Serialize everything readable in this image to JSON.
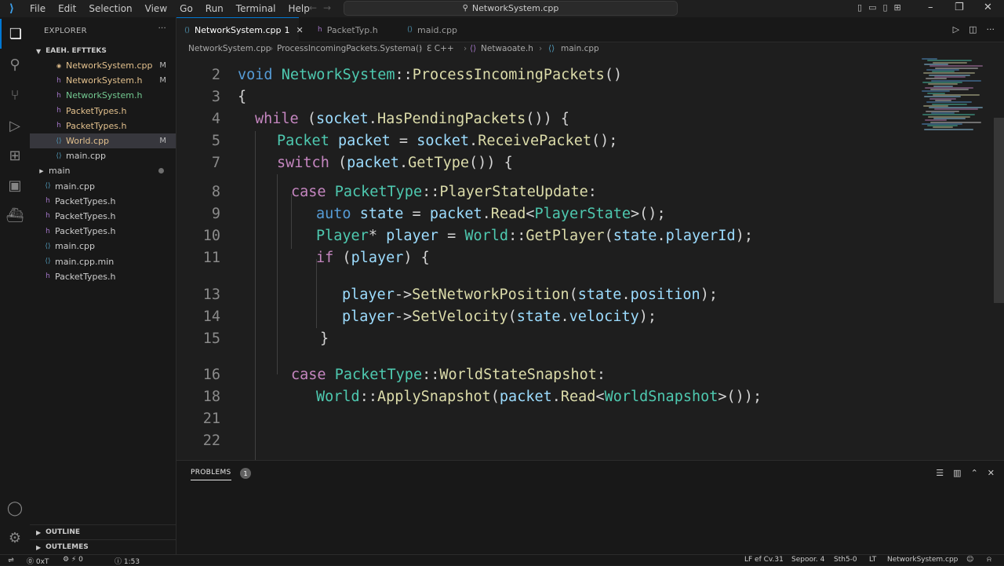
{
  "titlebar": {
    "menu": [
      "File",
      "Edit",
      "Selection",
      "View",
      "Go",
      "Run",
      "Terminal",
      "Help"
    ],
    "search_text": "NetworkSystem.cpp"
  },
  "sidebar": {
    "header": "EXPLORER",
    "section": "EAEH. EFTTEKS",
    "items": [
      {
        "label": "NetworkSystem.cpp",
        "status": "M",
        "color": "mod"
      },
      {
        "label": "NetworkSystem.h",
        "status": "M",
        "color": "mod"
      },
      {
        "label": "NetworkSystem.h",
        "status": "",
        "color": "new"
      },
      {
        "label": "PacketTypes.h",
        "status": "",
        "color": "mod"
      },
      {
        "label": "PacketTypes.h",
        "status": "",
        "color": "mod"
      },
      {
        "label": "World.cpp",
        "status": "M",
        "color": "mod"
      },
      {
        "label": "main.cpp",
        "status": "",
        "color": "def"
      },
      {
        "label": "main",
        "status": "",
        "color": "def"
      },
      {
        "label": "main.cpp",
        "status": "",
        "color": "def"
      },
      {
        "label": "PacketTypes.h",
        "status": "",
        "color": "def"
      },
      {
        "label": "PacketTypes.h",
        "status": "",
        "color": "def"
      },
      {
        "label": "PacketTypes.h",
        "status": "",
        "color": "def"
      },
      {
        "label": "main.cpp",
        "status": "",
        "color": "def"
      },
      {
        "label": "main.cpp.min",
        "status": "",
        "color": "def"
      },
      {
        "label": "PacketTypes.h",
        "status": "",
        "color": "def"
      }
    ],
    "outline": "OUTLINE",
    "outline2": "OUTLEMES"
  },
  "tabs": [
    {
      "label": "NetworkSystem.cpp",
      "badge": "1"
    },
    {
      "label": "PacketTyp.h"
    },
    {
      "label": "maid.cpp"
    }
  ],
  "breadcrumbs": [
    "NetworkSystem.cpp",
    "ProcessIncomingPackets.Systema()",
    "ℇ C++",
    "Netwaoate.h",
    "main.cpp"
  ],
  "code_lines": [
    {
      "n": "2",
      "t": [
        [
          "kw",
          "void "
        ],
        [
          "ty",
          "NetworkSystem"
        ],
        [
          "pn",
          "::"
        ],
        [
          "fn",
          "ProcessIncomingPackets"
        ],
        [
          "pn",
          "()"
        ]
      ]
    },
    {
      "n": "3",
      "t": [
        [
          "pn",
          "{"
        ]
      ]
    },
    {
      "n": "4",
      "t": [
        [
          "kc",
          "while "
        ],
        [
          "pn",
          "("
        ],
        [
          "var",
          "socket"
        ],
        [
          "pn",
          "."
        ],
        [
          "fn",
          "HasPendingPackets"
        ],
        [
          "pn",
          "()) {"
        ]
      ]
    },
    {
      "n": "5",
      "t": [
        [
          "ty",
          "Packet "
        ],
        [
          "var",
          "packet"
        ],
        [
          "pn",
          " = "
        ],
        [
          "var",
          "socket"
        ],
        [
          "pn",
          "."
        ],
        [
          "fn",
          "ReceivePacket"
        ],
        [
          "pn",
          "();"
        ]
      ]
    },
    {
      "n": "7",
      "t": [
        [
          "kc",
          "switch "
        ],
        [
          "pn",
          "("
        ],
        [
          "var",
          "packet"
        ],
        [
          "pn",
          "."
        ],
        [
          "fn",
          "GetType"
        ],
        [
          "pn",
          "()) {"
        ]
      ]
    },
    {
      "n": "8",
      "t": [
        [
          "kc",
          "case "
        ],
        [
          "ty",
          "PacketType"
        ],
        [
          "pn",
          "::"
        ],
        [
          "fn",
          "PlayerStateUpdate"
        ],
        [
          "pn",
          ":"
        ]
      ]
    },
    {
      "n": "9",
      "t": [
        [
          "kw",
          "auto "
        ],
        [
          "var",
          "state"
        ],
        [
          "pn",
          " = "
        ],
        [
          "var",
          "packet"
        ],
        [
          "pn",
          "."
        ],
        [
          "fn",
          "Read"
        ],
        [
          "pn",
          "<"
        ],
        [
          "ty",
          "PlayerState"
        ],
        [
          "pn",
          ">();"
        ]
      ]
    },
    {
      "n": "10",
      "t": [
        [
          "ty",
          "Player"
        ],
        [
          "pn",
          "* "
        ],
        [
          "var",
          "player"
        ],
        [
          "pn",
          " = "
        ],
        [
          "ty",
          "World"
        ],
        [
          "pn",
          "::"
        ],
        [
          "fn",
          "GetPlayer"
        ],
        [
          "pn",
          "("
        ],
        [
          "var",
          "state"
        ],
        [
          "pn",
          "."
        ],
        [
          "var",
          "playerId"
        ],
        [
          "pn",
          ");"
        ]
      ]
    },
    {
      "n": "11",
      "t": [
        [
          "kc",
          "if "
        ],
        [
          "pn",
          "("
        ],
        [
          "var",
          "player"
        ],
        [
          "pn",
          ") {"
        ]
      ]
    },
    {
      "n": "13",
      "t": [
        [
          "var",
          "player"
        ],
        [
          "pn",
          "->"
        ],
        [
          "fn",
          "SetNetworkPosition"
        ],
        [
          "pn",
          "("
        ],
        [
          "var",
          "state"
        ],
        [
          "pn",
          "."
        ],
        [
          "var",
          "position"
        ],
        [
          "pn",
          ");"
        ]
      ]
    },
    {
      "n": "14",
      "t": [
        [
          "var",
          "player"
        ],
        [
          "pn",
          "->"
        ],
        [
          "fn",
          "SetVelocity"
        ],
        [
          "pn",
          "("
        ],
        [
          "var",
          "state"
        ],
        [
          "pn",
          "."
        ],
        [
          "var",
          "velocity"
        ],
        [
          "pn",
          ");"
        ]
      ]
    },
    {
      "n": "15",
      "t": [
        [
          "pn",
          "}"
        ]
      ]
    },
    {
      "n": "16",
      "t": [
        [
          "kc",
          "case "
        ],
        [
          "ty",
          "PacketType"
        ],
        [
          "pn",
          "::"
        ],
        [
          "fn",
          "WorldStateSnapshot"
        ],
        [
          "pn",
          ":"
        ]
      ]
    },
    {
      "n": "18",
      "t": [
        [
          "ty",
          "World"
        ],
        [
          "pn",
          "::"
        ],
        [
          "fn",
          "ApplySnapshot"
        ],
        [
          "pn",
          "("
        ],
        [
          "var",
          "packet"
        ],
        [
          "pn",
          "."
        ],
        [
          "fn",
          "Read"
        ],
        [
          "pn",
          "<"
        ],
        [
          "ty",
          "WorldSnapshot"
        ],
        [
          "pn",
          ">());"
        ]
      ]
    },
    {
      "n": "21",
      "t": []
    },
    {
      "n": "22",
      "t": []
    }
  ],
  "panel": {
    "tab": "PROBLEMS",
    "count": "1"
  },
  "statusbar": {
    "left": [
      "⓪ 0x⁠T",
      "⚙ ⚡ 0",
      "ⓘ 1:53"
    ],
    "right": [
      "LF ef Cv.31",
      "Sepoor. 4",
      "Sth5-0",
      "LT",
      "NetworkSystem.cpp"
    ]
  }
}
